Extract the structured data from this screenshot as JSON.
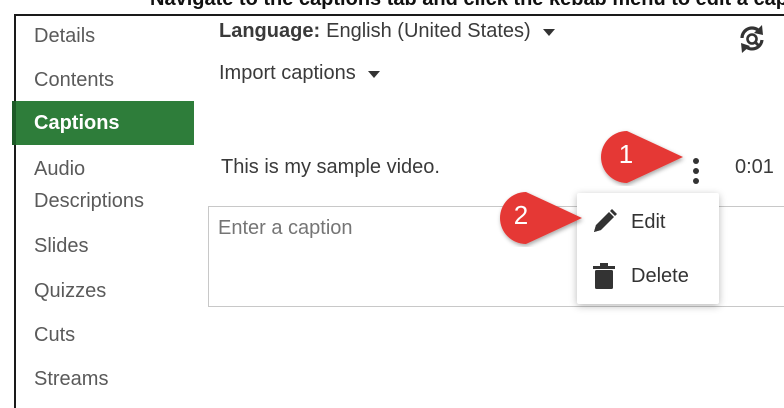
{
  "top_strip_text": "Navigate to the captions tab and click the kebab menu to edit a caption",
  "sidebar": {
    "items": [
      {
        "label": "Details",
        "active": false
      },
      {
        "label": "Contents",
        "active": false
      },
      {
        "label": "Captions",
        "active": true
      },
      {
        "label": "Audio Descriptions",
        "active": false
      },
      {
        "label": "Slides",
        "active": false
      },
      {
        "label": "Quizzes",
        "active": false
      },
      {
        "label": "Cuts",
        "active": false
      },
      {
        "label": "Streams",
        "active": false
      }
    ]
  },
  "header": {
    "language_label": "Language:",
    "language_value": "English (United States)",
    "import_label": "Import captions",
    "refresh_icon": "refresh-search-icon"
  },
  "caption": {
    "text": "This is my sample video.",
    "time": "0:01",
    "menu_icon": "kebab-menu-icon"
  },
  "input": {
    "placeholder": "Enter a caption"
  },
  "context_menu": {
    "items": [
      {
        "label": "Edit",
        "icon": "pencil-icon"
      },
      {
        "label": "Delete",
        "icon": "trash-icon"
      }
    ]
  },
  "callouts": [
    {
      "number": "1",
      "color": "#e53935"
    },
    {
      "number": "2",
      "color": "#e53935"
    }
  ],
  "colors": {
    "accent": "#2e7d3a",
    "callout": "#e53935"
  }
}
